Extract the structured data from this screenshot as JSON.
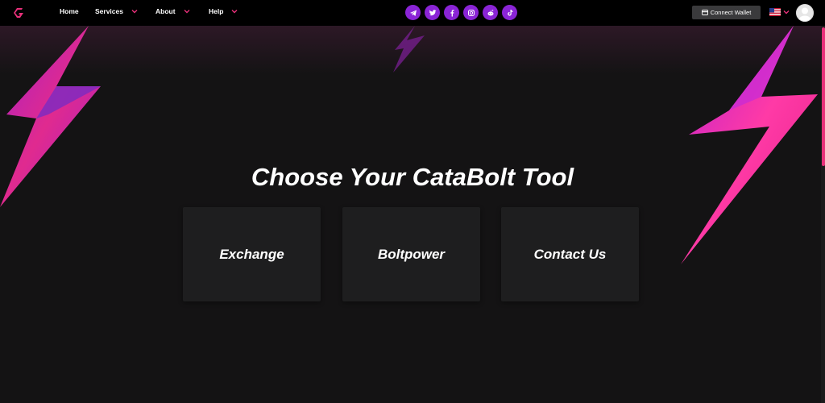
{
  "nav": {
    "logo_icon": "catabolt-logo-icon",
    "items": [
      {
        "label": "Home",
        "has_dropdown": false
      },
      {
        "label": "Services",
        "has_dropdown": true
      },
      {
        "label": "About",
        "has_dropdown": true
      },
      {
        "label": "Help",
        "has_dropdown": true
      }
    ],
    "socials": [
      "telegram-icon",
      "twitter-icon",
      "facebook-icon",
      "instagram-icon",
      "reddit-icon",
      "tiktok-icon"
    ],
    "wallet_label": "Connect Wallet",
    "language_flag": "us-flag-icon"
  },
  "hero": {
    "title": "Choose Your CataBolt Tool",
    "cards": [
      {
        "label": "Exchange"
      },
      {
        "label": "Boltpower"
      },
      {
        "label": "Contact Us"
      }
    ]
  },
  "colors": {
    "accent_purple": "#8a24d6",
    "accent_pink": "#e8307a",
    "background": "#141314",
    "card": "#1e1e1f"
  }
}
